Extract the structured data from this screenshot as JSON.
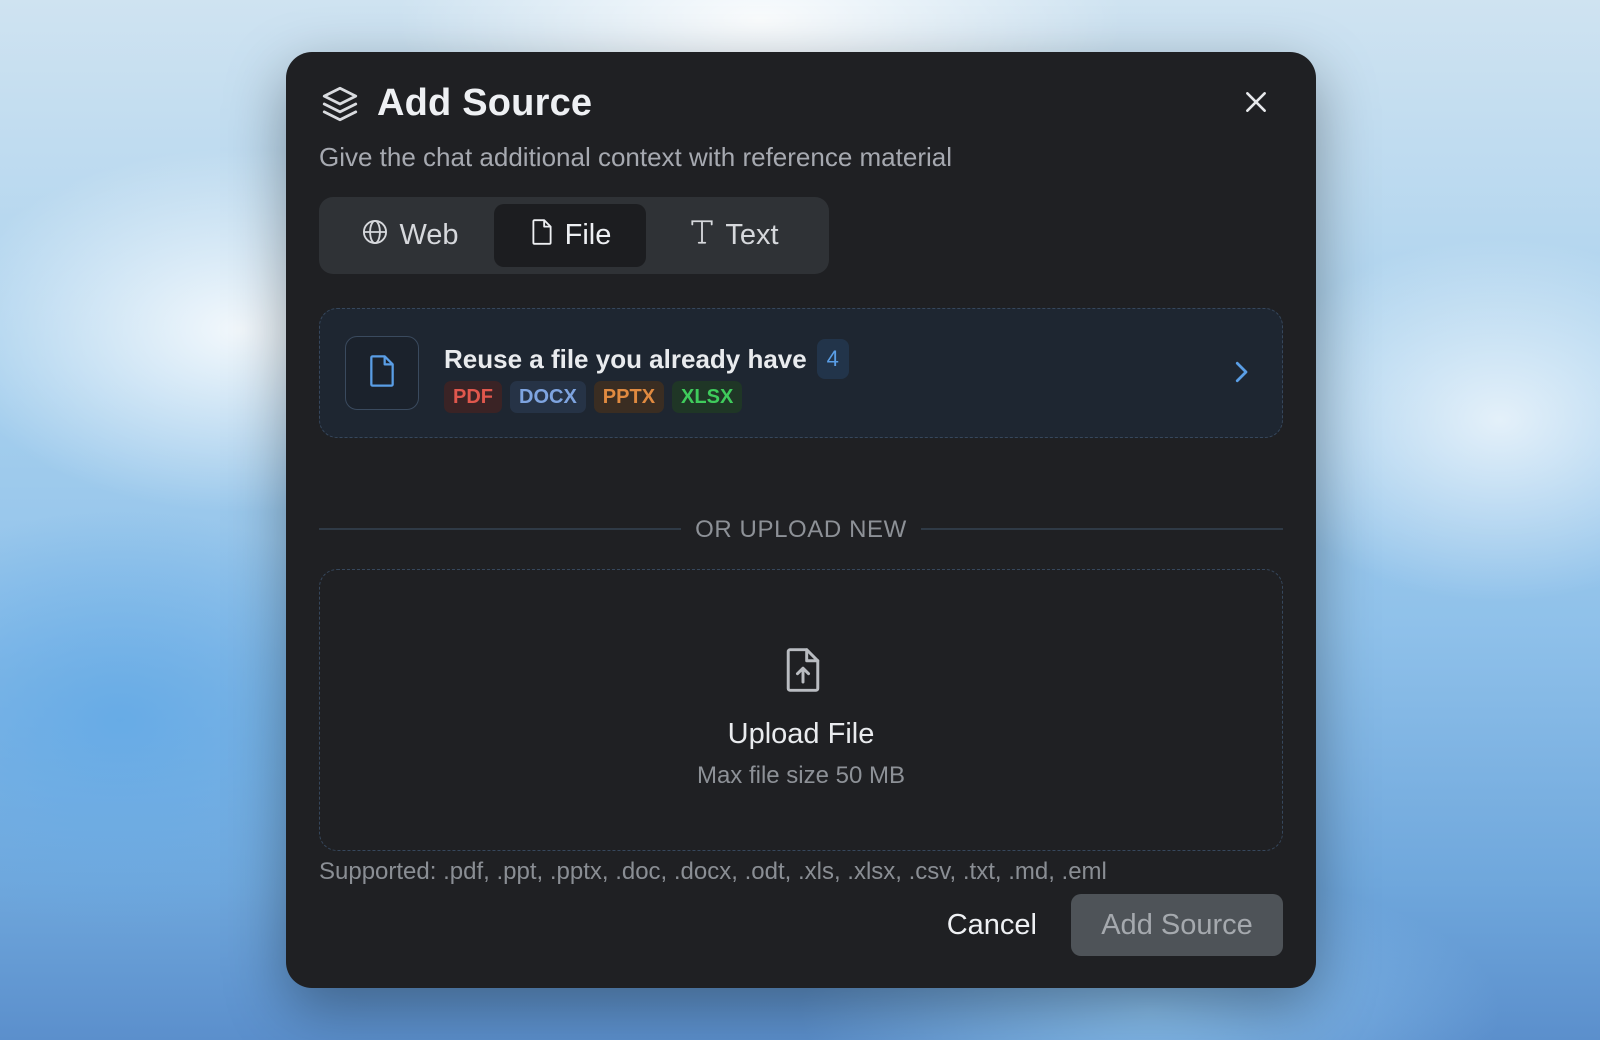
{
  "dialog": {
    "title": "Add Source",
    "subtitle": "Give the chat additional context with reference material",
    "title_icon": "layers-icon",
    "close_icon": "close-icon"
  },
  "tabs": [
    {
      "label": "Web",
      "icon": "globe-icon",
      "selected": false
    },
    {
      "label": "File",
      "icon": "file-icon",
      "selected": true
    },
    {
      "label": "Text",
      "icon": "text-icon",
      "selected": false
    }
  ],
  "reuse": {
    "title": "Reuse a file you already have",
    "count": "4",
    "icon": "file-icon",
    "tags": [
      {
        "label": "PDF",
        "color": "#e0574d"
      },
      {
        "label": "DOCX",
        "color": "#7ea4e0"
      },
      {
        "label": "PPTX",
        "color": "#e08a40"
      },
      {
        "label": "XLSX",
        "color": "#3fcb5c"
      }
    ],
    "chevron_icon": "chevron-right-icon"
  },
  "divider": {
    "label": "OR UPLOAD NEW"
  },
  "upload": {
    "icon": "file-upload-icon",
    "title": "Upload File",
    "subtitle": "Max file size 50 MB"
  },
  "supported": "Supported: .pdf, .ppt, .pptx, .doc, .docx, .odt, .xls, .xlsx, .csv, .txt, .md, .eml",
  "footer": {
    "cancel_label": "Cancel",
    "submit_label": "Add Source",
    "submit_disabled": true
  },
  "colors": {
    "modal_bg": "#1f2023",
    "accent_blue": "#5a9ee6"
  }
}
